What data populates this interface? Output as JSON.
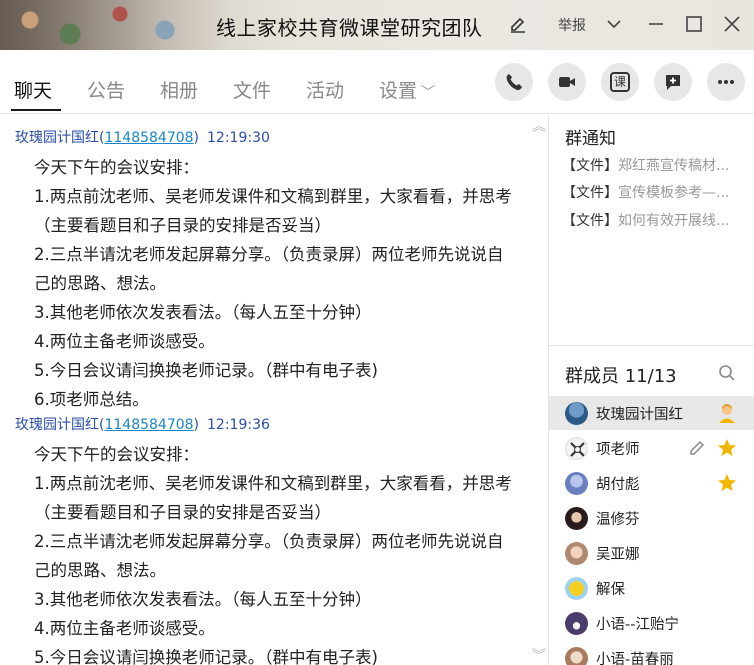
{
  "window": {
    "title": "线上家校共育微课堂研究团队",
    "report_label": "举报"
  },
  "tabs": [
    {
      "label": "聊天"
    },
    {
      "label": "公告"
    },
    {
      "label": "相册"
    },
    {
      "label": "文件"
    },
    {
      "label": "活动"
    },
    {
      "label": "设置"
    }
  ],
  "actions": {
    "ke_label": "课"
  },
  "chat": {
    "messages": [
      {
        "sender": "玫瑰园计国红",
        "qq": "1148584708",
        "time": "12:19:30",
        "lines": [
          "今天下午的会议安排：",
          "1.两点前沈老师、吴老师发课件和文稿到群里，大家看看，并思考",
          "（主要看题目和子目录的安排是否妥当）",
          "2.三点半请沈老师发起屏幕分享。（负责录屏）两位老师先说说自",
          "己的思路、想法。",
          "3.其他老师依次发表看法。（每人五至十分钟）",
          "4.两位主备老师谈感受。",
          "5.今日会议请闫换换老师记录。（群中有电子表)",
          "6.项老师总结。"
        ]
      },
      {
        "sender": "玫瑰园计国红",
        "qq": "1148584708",
        "time": "12:19:36",
        "lines": [
          "今天下午的会议安排：",
          "1.两点前沈老师、吴老师发课件和文稿到群里，大家看看，并思考",
          "（主要看题目和子目录的安排是否妥当）",
          "2.三点半请沈老师发起屏幕分享。（负责录屏）两位老师先说说自",
          "己的思路、想法。",
          "3.其他老师依次发表看法。（每人五至十分钟）",
          "4.两位主备老师谈感受。",
          "5.今日会议请闫换换老师记录。（群中有电子表)"
        ]
      }
    ]
  },
  "notice": {
    "title": "群通知",
    "items": [
      {
        "tag": "【文件】",
        "text": "郑红燕宣传稿材..."
      },
      {
        "tag": "【文件】",
        "text": "宣传模板参考—..."
      },
      {
        "tag": "【文件】",
        "text": "如何有效开展线..."
      }
    ]
  },
  "members": {
    "title": "群成员 11/13",
    "list": [
      {
        "name": "玫瑰园计国红",
        "avatar_color": "#3a6fa0",
        "badge": "owner-icon"
      },
      {
        "name": "项老师",
        "avatar_color": "#e8e8e8",
        "badge": "admin-star-icon",
        "editable": true
      },
      {
        "name": "胡付彪",
        "avatar_color": "#7a8ec8",
        "badge": "admin-star-icon"
      },
      {
        "name": "温修芬",
        "avatar_color": "#3b2a2a",
        "badge": ""
      },
      {
        "name": "吴亚娜",
        "avatar_color": "#d9b7a0",
        "badge": ""
      },
      {
        "name": "解保",
        "avatar_color": "#f0c020",
        "badge": ""
      },
      {
        "name": "小语--江贻宁",
        "avatar_color": "#5a4a7a",
        "badge": ""
      },
      {
        "name": "小语-苗春丽",
        "avatar_color": "#c9a080",
        "badge": ""
      }
    ]
  },
  "colors": {
    "accent_link": "#1a86c8",
    "sender": "#2b4fa8",
    "star": "#f2b600"
  }
}
